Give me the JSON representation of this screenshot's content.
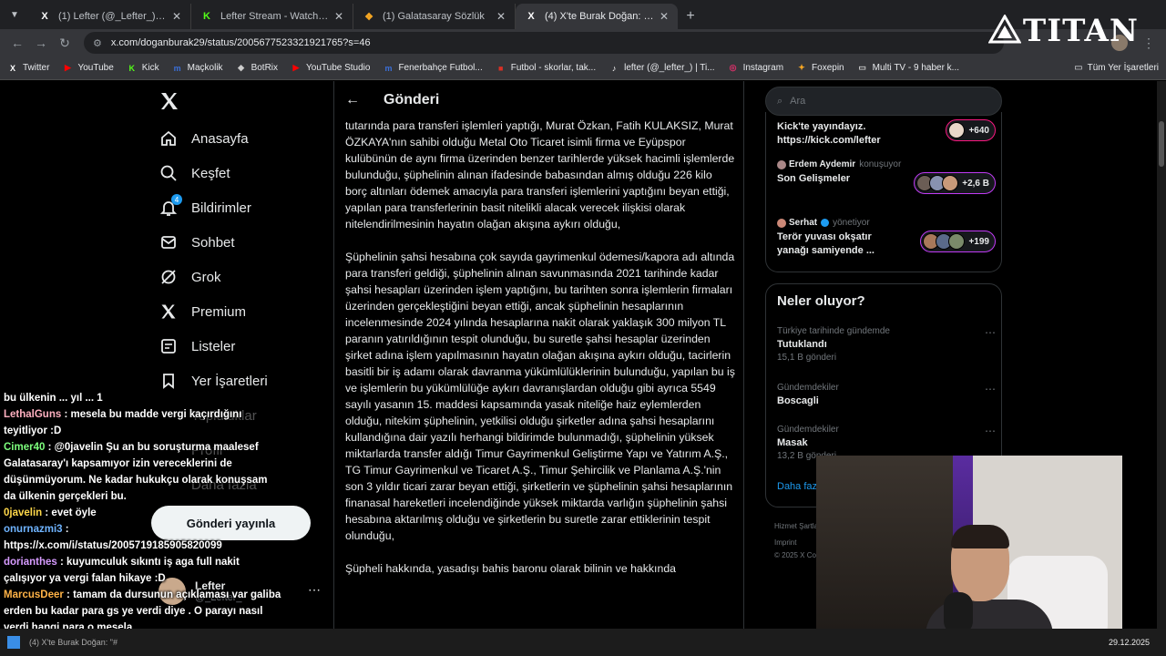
{
  "browser": {
    "tabs": [
      {
        "favicon": "X",
        "title": "(1) Lefter (@_Lefter_) / X",
        "color": "#ffffff",
        "active": false
      },
      {
        "favicon": "K",
        "title": "Lefter Stream - Watch Live on K",
        "color": "#53fc18",
        "active": false
      },
      {
        "favicon": "❖",
        "title": "(1) Galatasaray Sözlük",
        "color": "#f5a623",
        "active": false
      },
      {
        "favicon": "X",
        "title": "(4) X'te Burak Doğan: \"#ÖZELH",
        "color": "#ffffff",
        "active": true
      }
    ],
    "url": "x.com/doganburak29/status/2005677523321921765?s=46",
    "bookmarks": [
      {
        "icon": "X",
        "label": "Twitter",
        "color": "#ffffff"
      },
      {
        "icon": "▶",
        "label": "YouTube",
        "color": "#ff0000"
      },
      {
        "icon": "K",
        "label": "Kick",
        "color": "#53fc18"
      },
      {
        "icon": "m",
        "label": "Maçkolik",
        "color": "#3b6fd8"
      },
      {
        "icon": "◆",
        "label": "BotRix",
        "color": "#cccccc"
      },
      {
        "icon": "▶",
        "label": "YouTube Studio",
        "color": "#ff0000"
      },
      {
        "icon": "m",
        "label": "Fenerbahçe Futbol...",
        "color": "#3b6fd8"
      },
      {
        "icon": "■",
        "label": "Futbol - skorlar, tak...",
        "color": "#d93025"
      },
      {
        "icon": "♪",
        "label": "lefter (@_lefter_) | Ti...",
        "color": "#ffffff"
      },
      {
        "icon": "◎",
        "label": "Instagram",
        "color": "#e1306c"
      },
      {
        "icon": "✦",
        "label": "Foxepin",
        "color": "#f5a623"
      },
      {
        "icon": "▭",
        "label": "Multi TV - 9 haber k...",
        "color": "#cccccc"
      }
    ],
    "all_bookmarks": "Tüm Yer İşaretleri"
  },
  "overlay_logo": {
    "text": "TITAN"
  },
  "nav": {
    "items": [
      {
        "icon": "home-icon",
        "label": "Anasayfa"
      },
      {
        "icon": "search-icon",
        "label": "Keşfet"
      },
      {
        "icon": "bell-icon",
        "label": "Bildirimler",
        "badge": "4"
      },
      {
        "icon": "mail-icon",
        "label": "Sohbet"
      },
      {
        "icon": "grok-icon",
        "label": "Grok"
      },
      {
        "icon": "x-icon",
        "label": "Premium"
      },
      {
        "icon": "list-icon",
        "label": "Listeler"
      },
      {
        "icon": "bookmark-icon",
        "label": "Yer İşaretleri"
      },
      {
        "icon": "communities-icon",
        "label": "Topluluklar"
      },
      {
        "icon": "profile-icon",
        "label": "Profil"
      },
      {
        "icon": "more-icon",
        "label": "Daha fazla"
      }
    ],
    "post_button": "Gönderi yayınla",
    "account": {
      "name": "Lefter",
      "handle": "@_Lefter_"
    }
  },
  "main": {
    "title": "Gönderi",
    "paragraphs": [
      "tutarında para transferi işlemleri yaptığı, Murat Özkan, Fatih KULAKSIZ, Murat ÖZKAYA'nın sahibi olduğu Metal Oto Ticaret isimli firma ve Eyüpspor kulübünün de aynı firma üzerinden benzer tarihlerde yüksek hacimli işlemlerde bulunduğu, şüphelinin alınan ifadesinde babasından almış olduğu 226 kilo borç altınları ödemek amacıyla para transferi işlemlerini yaptığını beyan ettiği, yapılan para transferlerinin basit nitelikli alacak verecek ilişkisi olarak nitelendirilmesinin hayatın olağan akışına aykırı olduğu,",
      "Şüphelinin şahsi hesabına çok sayıda gayrimenkul ödemesi/kapora adı altında para transferi geldiği, şüphelinin alınan savunmasında 2021 tarihinde kadar şahsi hesapları üzerinden işlem yaptığını, bu tarihten sonra işlemlerin firmaları üzerinden gerçekleştiğini beyan ettiği, ancak şüphelinin hesaplarının incelenmesinde 2024 yılında hesaplarına nakit olarak yaklaşık 300 milyon TL paranın yatırıldığının tespit olunduğu, bu suretle şahsi hesaplar üzerinden şirket adına işlem yapılmasının hayatın olağan akışına aykırı olduğu, tacirlerin basitli bir iş adamı olarak davranma yükümlülüklerinin bulunduğu, yapılan bu iş ve işlemlerin bu yükümlülüğe aykırı davranışlardan olduğu gibi ayrıca 5549 sayılı yasanın 15. maddesi kapsamında yasak niteliğe haiz eylemlerden olduğu, nitekim şüphelinin, yetkilisi olduğu şirketler adına şahsi hesaplarını kullandığına dair yazılı herhangi bildirimde bulunmadığı, şüphelinin yüksek miktarlarda transfer aldığı Timur Gayrimenkul Geliştirme Yapı ve Yatırım A.Ş., TG Timur Gayrimenkul ve Ticaret A.Ş., Timur Şehircilik ve Planlama A.Ş.'nin son 3 yıldır ticari zarar beyan ettiği, şirketlerin ve şüphelinin şahsi hesaplarının finanasal hareketleri incelendiğinde yüksek miktarda varlığın şüphelinin şahsi hesabına aktarılmış olduğu ve şirketlerin bu suretle zarar ettiklerinin tespit olunduğu,",
      "Şüpheli hakkında, yasadışı bahis baronu olarak bilinin ve hakkında"
    ]
  },
  "sidebar": {
    "search_placeholder": "Ara",
    "spaces": [
      {
        "host": "",
        "role": "",
        "title": "Kick'te yayındayız. https://kick.com/lefter",
        "count": "+640"
      },
      {
        "host": "Erdem Aydemir",
        "role": "konuşuyor",
        "title": "Son Gelişmeler",
        "count": "+2,6 B"
      },
      {
        "host": "Serhat",
        "role": "yönetiyor",
        "title": "Terör yuvası okşatır yanağı samiyende ...",
        "count": "+199"
      }
    ],
    "trends_title": "Neler oluyor?",
    "trends": [
      {
        "meta": "Türkiye tarihinde gündemde",
        "name": "Tutuklandı",
        "count": "15,1 B gönderi"
      },
      {
        "meta": "Gündemdekiler",
        "name": "Boscagli",
        "count": ""
      },
      {
        "meta": "Gündemdekiler",
        "name": "Masak",
        "count": "13,2 B gönderi"
      }
    ],
    "show_more": "Daha fazla",
    "footer_lines": [
      "Hizmet Şartları",
      "Imprint",
      "© 2025 X Corp."
    ]
  },
  "chat": [
    {
      "user": "",
      "color": "#ffffff",
      "text": "bu ülkenin ... yıl ... 1"
    },
    {
      "user": "LethalGuns",
      "color": "#ffb0c0",
      "text": ": mesela bu madde vergi kaçırdığını teyitliyor :D"
    },
    {
      "user": "Cimer40",
      "color": "#7dff7d",
      "text": ": @0javelin Şu an bu soruşturma maalesef Galatasaray'ı kapsamıyor izin vereceklerini de düşünmüyorum. Ne kadar hukukçu olarak konuşsam da ülkenin gerçekleri bu."
    },
    {
      "user": "0javelin",
      "color": "#ffd84a",
      "text": ": evet öyle"
    },
    {
      "user": "onurnazmi3",
      "color": "#6fb4ff",
      "text": ": https://x.com/i/status/2005719185905820099"
    },
    {
      "user": "dorianthes",
      "color": "#d69bff",
      "text": ": kuyumculuk sıkıntı iş aga full nakit çalışıyor ya vergi falan hikaye :D"
    },
    {
      "user": "MarcusDeer",
      "color": "#ffb347",
      "text": ": tamam da dursunun açıklaması var galiba erden bu kadar para gs ye verdi diye . O parayı nasıl verdi hangi para o mesela"
    }
  ],
  "taskbar": {
    "item": "(4) X'te Burak Doğan: \"#",
    "date": "29.12.2025"
  }
}
